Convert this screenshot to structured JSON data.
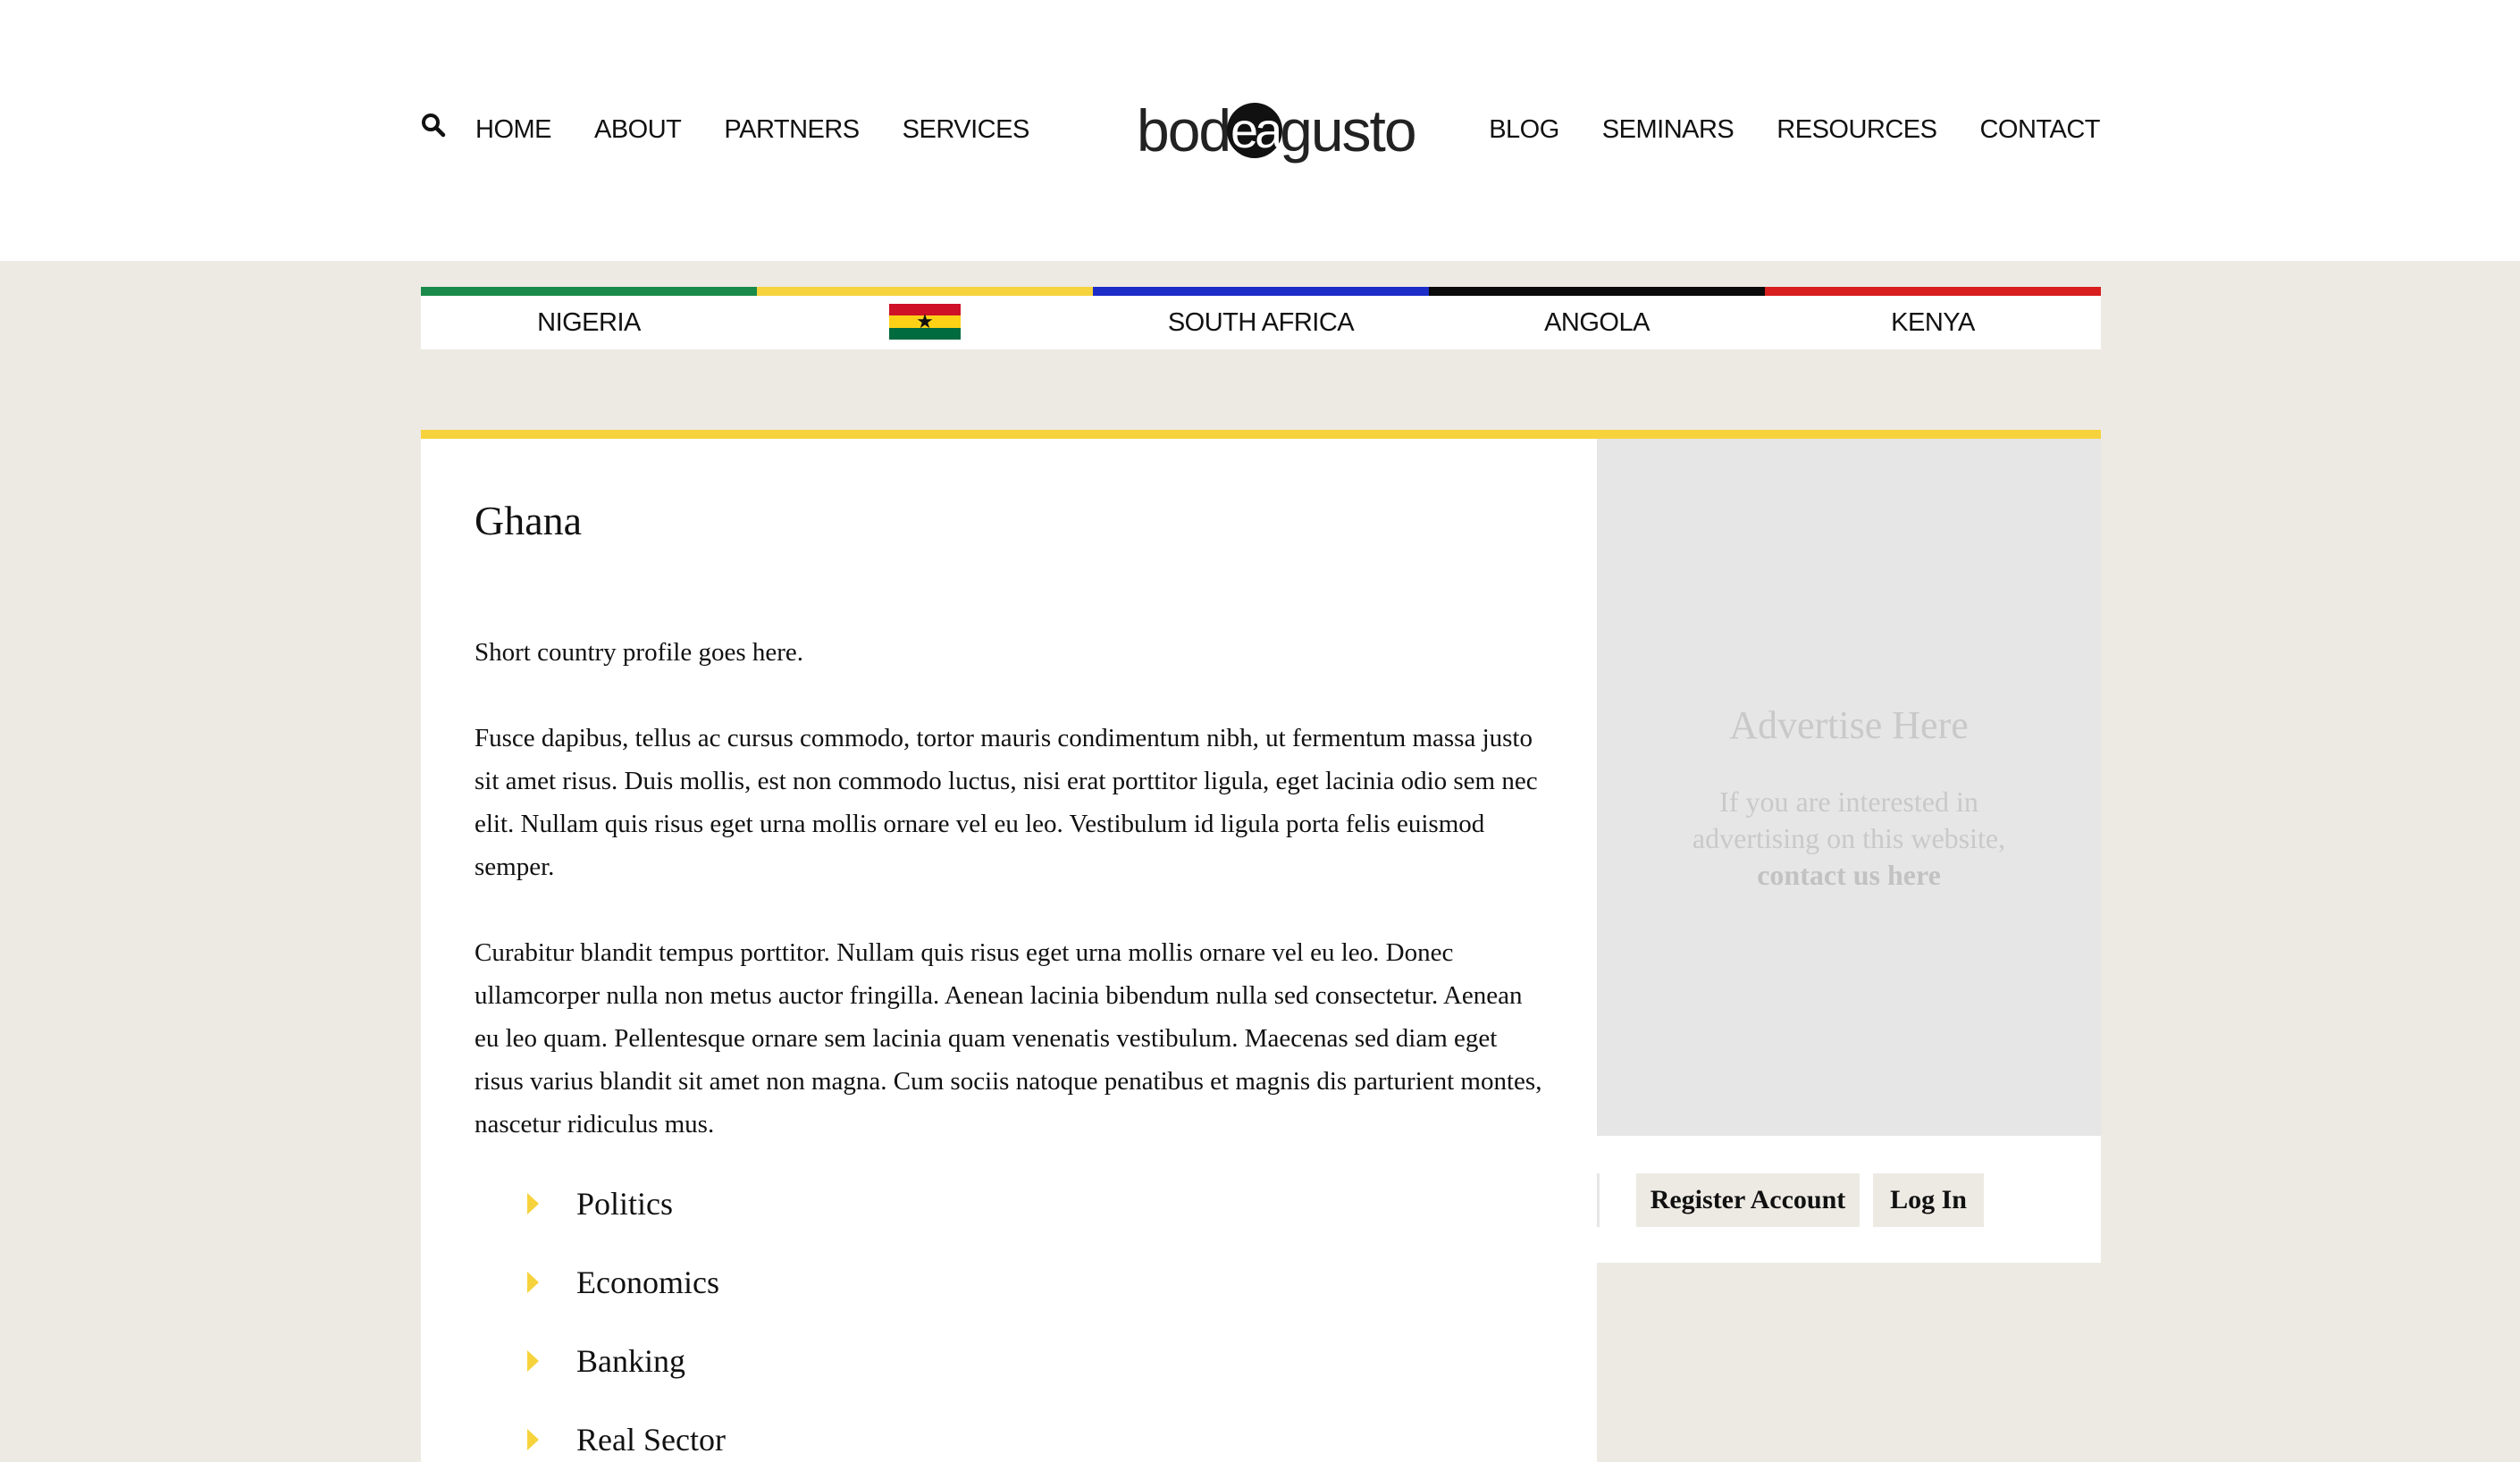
{
  "header": {
    "logo": {
      "text_before": "bod",
      "text_circle": "ea",
      "text_after": "gusto"
    },
    "nav_left": [
      "HOME",
      "ABOUT",
      "PARTNERS",
      "SERVICES"
    ],
    "nav_right": [
      "BLOG",
      "SEMINARS",
      "RESOURCES",
      "CONTACT"
    ],
    "search_icon": "search-icon"
  },
  "countries": [
    {
      "label": "NIGERIA",
      "color": "#1a8a4a"
    },
    {
      "label": "",
      "color": "#f6d33c",
      "active": true,
      "flag": "ghana-flag",
      "flag_colors": [
        "#ce1126",
        "#fcd116",
        "#006b3f"
      ],
      "flag_star": "★"
    },
    {
      "label": "SOUTH AFRICA",
      "color": "#1c2dc8"
    },
    {
      "label": "ANGOLA",
      "color": "#0a0a0a"
    },
    {
      "label": "KENYA",
      "color": "#d81e1e"
    }
  ],
  "accent_color": "#f6d33c",
  "main": {
    "title": "Ghana",
    "paragraphs": [
      "Short country profile goes here.",
      "Fusce dapibus, tellus ac cursus commodo, tortor mauris condimentum nibh, ut fermentum massa justo sit amet risus. Duis mollis, est non commodo luctus, nisi erat porttitor ligula, eget lacinia odio sem nec elit. Nullam quis risus eget urna mollis ornare vel eu leo. Vestibulum id ligula porta felis euismod semper.",
      "Curabitur blandit tempus porttitor. Nullam quis risus eget urna mollis ornare vel eu leo. Donec ullamcorper nulla non metus auctor fringilla. Aenean lacinia bibendum nulla sed consectetur. Aenean eu leo quam. Pellentesque ornare sem lacinia quam venenatis vestibulum. Maecenas sed diam eget risus varius blandit sit amet non magna. Cum sociis natoque penatibus et magnis dis parturient montes, nascetur ridiculus mus."
    ],
    "topics": [
      "Politics",
      "Economics",
      "Banking",
      "Real Sector"
    ]
  },
  "sidebar": {
    "ad_title": "Advertise Here",
    "ad_text": "If you are interested in advertising on this website,",
    "ad_link": "contact us here",
    "register_label": "Register Account",
    "login_label": "Log In"
  }
}
